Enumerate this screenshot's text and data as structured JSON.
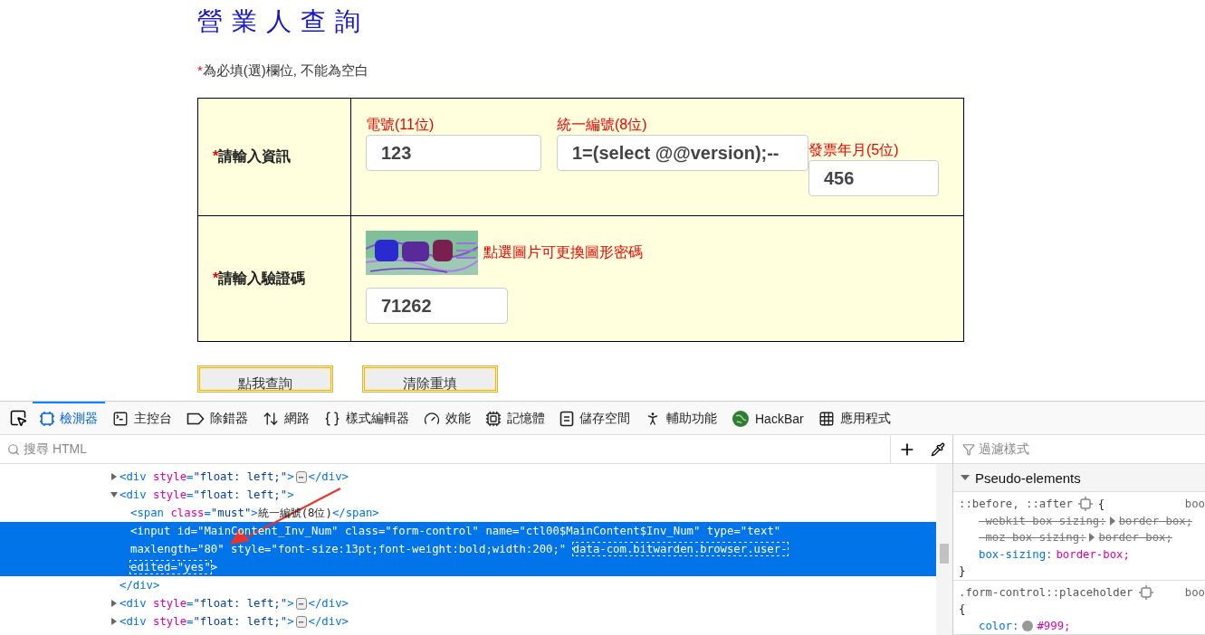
{
  "page": {
    "title": "營業人查詢",
    "required_mark": "*",
    "note": "為必填(選)欄位, 不能為空白",
    "rows": [
      {
        "mark": "*",
        "label": "請輸入資訊",
        "kind": "fields",
        "fields": [
          {
            "label": "電號(11位)",
            "value": "123"
          },
          {
            "label": "統一編號(8位)",
            "value": "1=(select @@version);--"
          },
          {
            "label": "發票年月(5位)",
            "value": "456"
          }
        ]
      },
      {
        "mark": "*",
        "label": "請輸入驗證碼",
        "kind": "captcha",
        "hint": "點選圖片可更換圖形密碼",
        "value": "71262"
      }
    ],
    "buttons": [
      "點我查詢",
      "清除重填"
    ]
  },
  "devtools": {
    "tabs": [
      {
        "label": "檢測器",
        "selected": true
      },
      {
        "label": "主控台",
        "selected": false
      },
      {
        "label": "除錯器",
        "selected": false
      },
      {
        "label": "網路",
        "selected": false
      },
      {
        "label": "樣式編輯器",
        "selected": false
      },
      {
        "label": "效能",
        "selected": false
      },
      {
        "label": "記憶體",
        "selected": false
      },
      {
        "label": "儲存空間",
        "selected": false
      },
      {
        "label": "輔助功能",
        "selected": false
      },
      {
        "label": "HackBar",
        "selected": false
      },
      {
        "label": "應用程式",
        "selected": false
      }
    ],
    "search": {
      "placeholder": "搜尋 HTML"
    },
    "tree": [
      {
        "expanded": false,
        "selected": false,
        "parts": [
          {
            "kind": "tag",
            "text": "<div "
          },
          {
            "kind": "attr",
            "text": "style"
          },
          {
            "kind": "punct",
            "text": "="
          },
          {
            "kind": "value",
            "text": "\"float: left;\""
          },
          {
            "kind": "tag",
            "text": ">"
          }
        ],
        "badge": "⋯",
        "tail": [
          {
            "kind": "tag",
            "text": "</div>"
          }
        ]
      },
      {
        "expanded": true,
        "selected": false,
        "parts": [
          {
            "kind": "tag",
            "text": "<div "
          },
          {
            "kind": "attr",
            "text": "style"
          },
          {
            "kind": "punct",
            "text": "="
          },
          {
            "kind": "value",
            "text": "\"float: left;\""
          },
          {
            "kind": "tag",
            "text": ">"
          }
        ],
        "children": [
          {
            "selected": false,
            "parts": [
              {
                "kind": "tag",
                "text": "<span "
              },
              {
                "kind": "attr",
                "text": "class"
              },
              {
                "kind": "punct",
                "text": "="
              },
              {
                "kind": "value",
                "text": "\"must\""
              },
              {
                "kind": "tag",
                "text": ">"
              },
              {
                "kind": "plain",
                "text": "統一編號(8位)"
              },
              {
                "kind": "tag",
                "text": "</span>"
              }
            ]
          },
          {
            "selected": true,
            "parts": [
              {
                "kind": "tag",
                "text": "<input "
              },
              {
                "kind": "attr",
                "text": "id"
              },
              {
                "kind": "punct",
                "text": "="
              },
              {
                "kind": "value",
                "text": "\"MainContent_Inv_Num\" "
              },
              {
                "kind": "attr",
                "text": "class"
              },
              {
                "kind": "punct",
                "text": "="
              },
              {
                "kind": "value",
                "text": "\"form-control\" "
              },
              {
                "kind": "attr",
                "text": "name"
              },
              {
                "kind": "punct",
                "text": "="
              },
              {
                "kind": "value",
                "text": "\"ctl00$MainContent$Inv_Num\" "
              },
              {
                "kind": "attr",
                "text": "type"
              },
              {
                "kind": "punct",
                "text": "="
              },
              {
                "kind": "value",
                "text": "\"text\" "
              },
              {
                "kind": "attr",
                "text": "maxlength"
              },
              {
                "kind": "punct",
                "text": "="
              },
              {
                "kind": "value",
                "text": "\"80\" "
              },
              {
                "kind": "attr",
                "text": "style"
              },
              {
                "kind": "punct",
                "text": "="
              },
              {
                "kind": "value",
                "text": "\"font-size:13pt;font-weight:bold;width:200;\" "
              },
              {
                "kind": "flagged",
                "text": "data-com.bitwarden.browser.user-edited=\"yes\""
              },
              {
                "kind": "tag",
                "text": ">"
              }
            ]
          }
        ],
        "closing": [
          {
            "kind": "tag",
            "text": "</div>"
          }
        ]
      },
      {
        "expanded": false,
        "selected": false,
        "parts": [
          {
            "kind": "tag",
            "text": "<div "
          },
          {
            "kind": "attr",
            "text": "style"
          },
          {
            "kind": "punct",
            "text": "="
          },
          {
            "kind": "value",
            "text": "\"float: left;\""
          },
          {
            "kind": "tag",
            "text": ">"
          }
        ],
        "badge": "⋯",
        "tail": [
          {
            "kind": "tag",
            "text": "</div>"
          }
        ]
      },
      {
        "expanded": false,
        "selected": false,
        "parts": [
          {
            "kind": "tag",
            "text": "<div "
          },
          {
            "kind": "attr",
            "text": "style"
          },
          {
            "kind": "punct",
            "text": "="
          },
          {
            "kind": "value",
            "text": "\"float: left;\""
          },
          {
            "kind": "tag",
            "text": ">"
          }
        ],
        "badge": "⋯",
        "tail": [
          {
            "kind": "tag",
            "text": "</div>"
          }
        ]
      }
    ],
    "styles": {
      "filter_placeholder": "過濾樣式",
      "section": {
        "title": "Pseudo-elements",
        "expanded": true
      },
      "rules": [
        {
          "selector": "::before, ::after",
          "open": "{",
          "source": "boo",
          "decls": [
            {
              "prop": "-webkit-box-sizing:",
              "value": "border-box;",
              "overridden": true
            },
            {
              "prop": "-moz-box-sizing:",
              "value": "border-box;",
              "overridden": true
            },
            {
              "prop": "box-sizing:",
              "value": "border-box;",
              "overridden": false
            }
          ],
          "close": "}"
        },
        {
          "selector": ".form-control::placeholder",
          "open": "{",
          "source": "boo",
          "decls": [
            {
              "prop": "color:",
              "value": "#999;",
              "overridden": false,
              "color": "#999999"
            }
          ]
        }
      ]
    }
  }
}
